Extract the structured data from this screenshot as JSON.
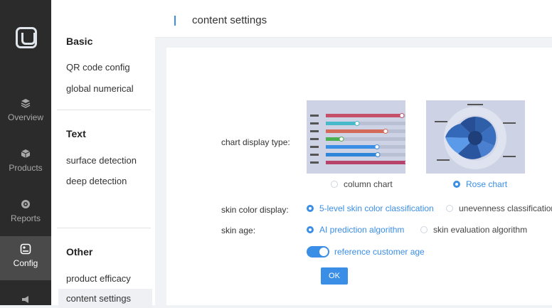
{
  "rail": {
    "items": [
      {
        "label": "Overview",
        "icon": "layers-icon"
      },
      {
        "label": "Products",
        "icon": "cube-icon"
      },
      {
        "label": "Reports",
        "icon": "report-icon"
      },
      {
        "label": "Config",
        "icon": "config-icon"
      }
    ]
  },
  "submenu": {
    "basic_title": "Basic",
    "basic_items": [
      "QR code config",
      "global numerical"
    ],
    "text_title": "Text",
    "text_items": [
      "surface detection",
      "deep detection"
    ],
    "other_title": "Other",
    "other_items": [
      "product efficacy",
      "content settings"
    ]
  },
  "header": {
    "title": "content settings"
  },
  "form": {
    "chart_type_label": "chart display type:",
    "chart_options": [
      "column chart",
      "Rose chart"
    ],
    "chart_selected": "Rose chart",
    "skin_color_label": "skin color display:",
    "skin_color_options": [
      "5-level skin color classification",
      "unevenness classification"
    ],
    "skin_color_selected": "5-level skin color classification",
    "skin_age_label": "skin age:",
    "skin_age_options": [
      "AI prediction algorithm",
      "skin evaluation algorithm"
    ],
    "skin_age_selected": "AI prediction algorithm",
    "toggle_label": "reference customer age",
    "toggle_on": true,
    "ok_label": "OK"
  },
  "colors": {
    "accent": "#3a8ee6",
    "rail": "#2b2b2b"
  }
}
